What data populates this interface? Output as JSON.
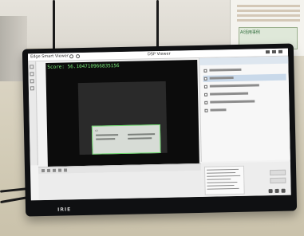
{
  "overlay": {
    "score_text": "Score: 56.104710966835156"
  },
  "monitor": {
    "brand": "IRIE"
  },
  "app": {
    "title": "Edge Smart Viewer",
    "window_title": "DSP Viewer"
  },
  "poster": {
    "label": "AI活用事例"
  },
  "colors": {
    "overlay_text": "#7df07d",
    "detection_box": "#6cd86c",
    "screen_bg": "#f2f2f2",
    "viewer_bg": "#0c0c0c",
    "selection": "#c9d9ea"
  }
}
